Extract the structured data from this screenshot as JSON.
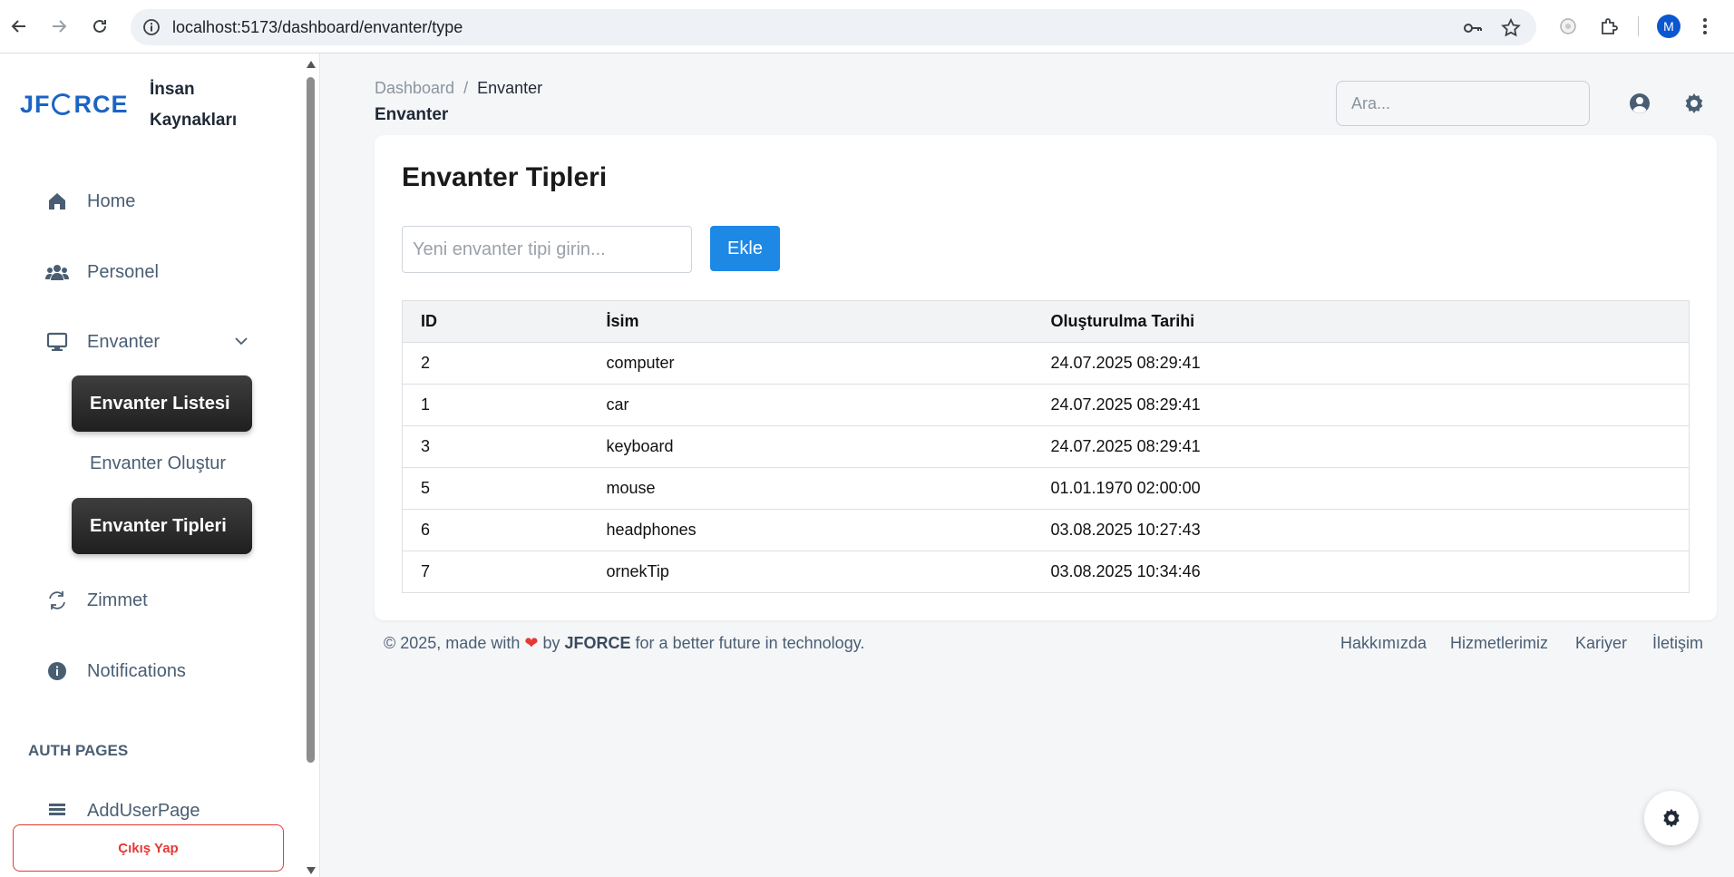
{
  "browser": {
    "url": "localhost:5173/dashboard/envanter/type",
    "profile_initial": "M"
  },
  "sidebar": {
    "logo_text": "JFORCE",
    "brand_title": "İnsan Kaynakları",
    "items": [
      {
        "label": "Home",
        "icon": "home-icon"
      },
      {
        "label": "Personel",
        "icon": "users-icon"
      },
      {
        "label": "Envanter",
        "icon": "monitor-icon"
      },
      {
        "label": "Zimmet",
        "icon": "refresh-icon"
      },
      {
        "label": "Notifications",
        "icon": "info-icon"
      }
    ],
    "sub_items": [
      {
        "label": "Envanter Listesi"
      },
      {
        "label": "Envanter Oluştur"
      },
      {
        "label": "Envanter Tipleri"
      }
    ],
    "auth_heading": "AUTH PAGES",
    "auth_items": [
      {
        "label": "AddUserPage"
      }
    ],
    "logout_label": "Çıkış Yap"
  },
  "header": {
    "breadcrumb_root": "Dashboard",
    "breadcrumb_separator": "/",
    "breadcrumb_current": "Envanter",
    "page_subtitle": "Envanter",
    "search_placeholder": "Ara..."
  },
  "main": {
    "title": "Envanter Tipleri",
    "input_placeholder": "Yeni envanter tipi girin...",
    "add_button_label": "Ekle",
    "table": {
      "headers": [
        "ID",
        "İsim",
        "Oluşturulma Tarihi"
      ],
      "rows": [
        {
          "id": "2",
          "name": "computer",
          "created": "24.07.2025 08:29:41"
        },
        {
          "id": "1",
          "name": "car",
          "created": "24.07.2025 08:29:41"
        },
        {
          "id": "3",
          "name": "keyboard",
          "created": "24.07.2025 08:29:41"
        },
        {
          "id": "5",
          "name": "mouse",
          "created": "01.01.1970 02:00:00"
        },
        {
          "id": "6",
          "name": "headphones",
          "created": "03.08.2025 10:27:43"
        },
        {
          "id": "7",
          "name": "ornekTip",
          "created": "03.08.2025 10:34:46"
        }
      ]
    }
  },
  "footer": {
    "copyright_prefix": "© 2025, made with",
    "by_text": "by",
    "brand": "JFORCE",
    "suffix": "for a better future in technology.",
    "links": [
      "Hakkımızda",
      "Hizmetlerimiz",
      "Kariyer",
      "İletişim"
    ]
  },
  "colors": {
    "primary": "#1e88e5",
    "danger": "#e53935",
    "active_menu": "#2a2a2a",
    "muted_text": "#4a5e73"
  }
}
